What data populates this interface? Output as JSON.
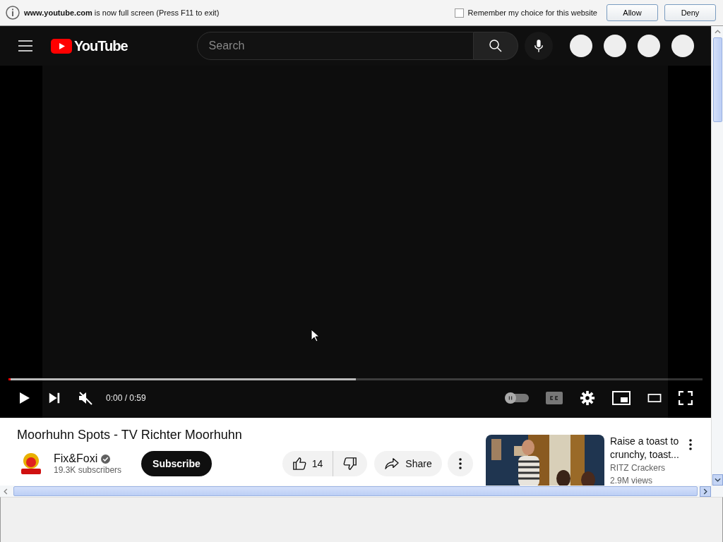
{
  "notification": {
    "site": "www.youtube.com",
    "message": "is now full screen (Press F11 to exit)",
    "remember": {
      "label": "Remember my choice for this website",
      "checked": false
    },
    "buttons": [
      "Allow",
      "Deny"
    ]
  },
  "header": {
    "logo": "YouTube",
    "search": {
      "placeholder": "Search"
    }
  },
  "player": {
    "buffer": {
      "level": 0.5
    },
    "progress": {
      "level": 0.0
    },
    "muted": true,
    "time": "0:00 / 0:59",
    "autoplay": {
      "on": false
    }
  },
  "video": {
    "title": "Moorhuhn Spots - TV Richter Moorhuhn",
    "channel": "Fix&Foxi",
    "verified": true,
    "subscribers": "19.3K subscribers",
    "subscribe": "Subscribe",
    "likes": "14",
    "share": "Share"
  },
  "recommendation": {
    "title_lines": [
      "Raise a toast to",
      "crunchy, toast..."
    ],
    "channel": "RITZ Crackers",
    "views": "2.9M views"
  }
}
